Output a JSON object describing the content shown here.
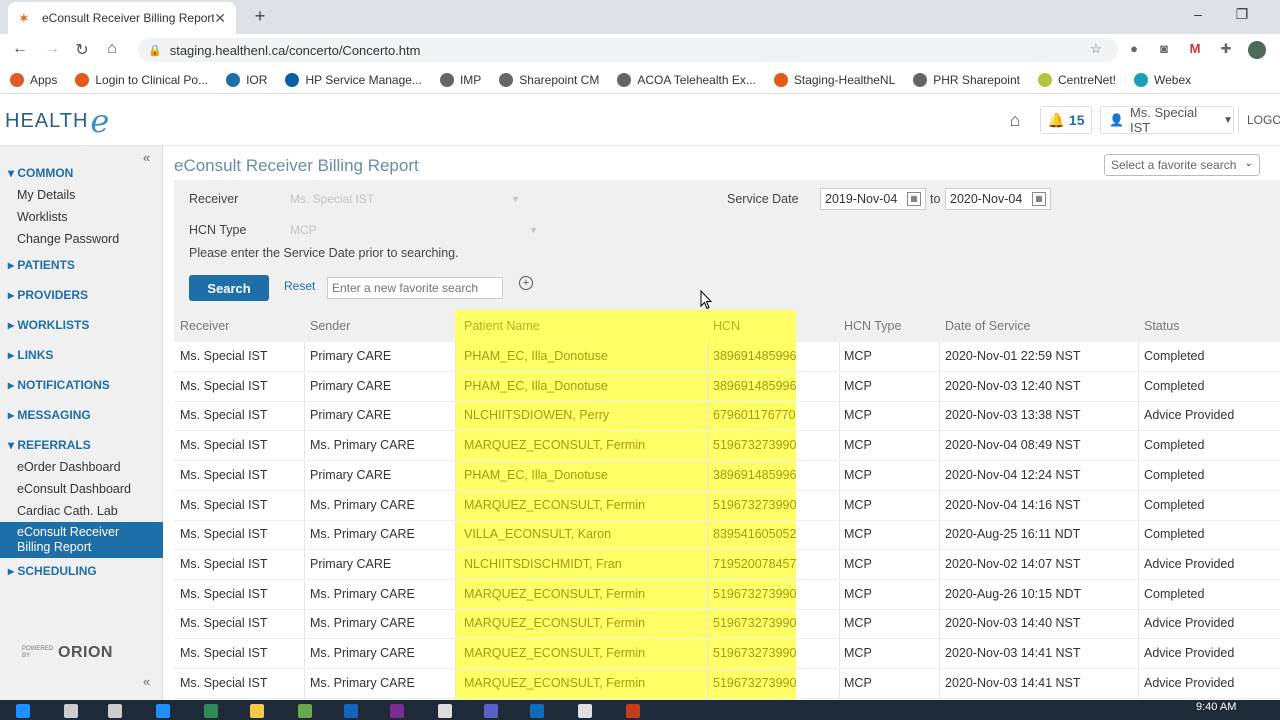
{
  "browser": {
    "tab_title": "eConsult Receiver Billing Report",
    "tab_close": "✕",
    "new_tab": "+",
    "url": "staging.healthenl.ca/concerto/Concerto.htm",
    "bookmarks": [
      {
        "label": "Apps",
        "icon": "apps-icon",
        "color": "#e05a2a"
      },
      {
        "label": "Login to Clinical Po...",
        "icon": "orion-icon",
        "color": "#e35b16"
      },
      {
        "label": "IOR",
        "icon": "ior-icon",
        "color": "#1e6ea8"
      },
      {
        "label": "HP Service Manage...",
        "icon": "hp-icon",
        "color": "#0a5fa8"
      },
      {
        "label": "IMP",
        "icon": "globe-icon",
        "color": "#666666"
      },
      {
        "label": "Sharepoint CM",
        "icon": "globe-icon",
        "color": "#666666"
      },
      {
        "label": "ACOA Telehealth Ex...",
        "icon": "globe-icon",
        "color": "#666666"
      },
      {
        "label": "Staging-HealtheNL",
        "icon": "orion-icon",
        "color": "#e35b16"
      },
      {
        "label": "PHR Sharepoint",
        "icon": "globe-icon",
        "color": "#666666"
      },
      {
        "label": "CentreNet!",
        "icon": "centrenet-icon",
        "color": "#b6c43a"
      },
      {
        "label": "Webex",
        "icon": "webex-icon",
        "color": "#1a9fb8"
      }
    ]
  },
  "app": {
    "logo_a": "HEALTH",
    "logo_b": "e",
    "notification_count": "15",
    "user_name": "Ms. Special IST",
    "logout": "LOGOUT"
  },
  "sidebar": {
    "sections": [
      {
        "label": "▾ COMMON",
        "items": [
          "My Details",
          "Worklists",
          "Change Password"
        ]
      },
      {
        "label": "▸ PATIENTS",
        "items": []
      },
      {
        "label": "▸ PROVIDERS",
        "items": []
      },
      {
        "label": "▸ WORKLISTS",
        "items": []
      },
      {
        "label": "▸ LINKS",
        "items": []
      },
      {
        "label": "▸ NOTIFICATIONS",
        "items": []
      },
      {
        "label": "▸ MESSAGING",
        "items": []
      },
      {
        "label": "▾ REFERRALS",
        "items": [
          "eOrder Dashboard",
          "eConsult Dashboard",
          "Cardiac Cath. Lab",
          "eConsult Receiver Billing Report"
        ]
      },
      {
        "label": "▸ SCHEDULING",
        "items": []
      }
    ],
    "powered_by": "POWERED BY",
    "orion": "ORION"
  },
  "page": {
    "title": "eConsult Receiver Billing Report",
    "favorite_select_placeholder": "Select a favorite search",
    "form": {
      "receiver_label": "Receiver",
      "receiver_value": "Ms. Special IST",
      "hcn_type_label": "HCN Type",
      "hcn_type_value": "MCP",
      "service_date_label": "Service Date",
      "date_from": "2019-Nov-04",
      "date_to_label": "to",
      "date_to": "2020-Nov-04",
      "hint": "Please enter the Service Date prior to searching.",
      "search_button": "Search",
      "reset_link": "Reset",
      "favorite_placeholder": "Enter a new favorite search"
    },
    "table": {
      "highlight_color": "#ffff66",
      "columns": [
        "Receiver",
        "Sender",
        "Patient Name",
        "HCN",
        "HCN Type",
        "Date of Service",
        "Status"
      ],
      "rows": [
        [
          "Ms. Special IST",
          "Primary CARE",
          "PHAM_EC, Illa_Donotuse",
          "389691485996",
          "MCP",
          "2020-Nov-01 22:59 NST",
          "Completed"
        ],
        [
          "Ms. Special IST",
          "Primary CARE",
          "PHAM_EC, Illa_Donotuse",
          "389691485996",
          "MCP",
          "2020-Nov-03 12:40 NST",
          "Completed"
        ],
        [
          "Ms. Special IST",
          "Primary CARE",
          "NLCHIITSDIOWEN, Perry",
          "679601176770",
          "MCP",
          "2020-Nov-03 13:38 NST",
          "Advice Provided"
        ],
        [
          "Ms. Special IST",
          "Ms. Primary CARE",
          "MARQUEZ_ECONSULT, Fermin",
          "519673273990",
          "MCP",
          "2020-Nov-04 08:49 NST",
          "Completed"
        ],
        [
          "Ms. Special IST",
          "Primary CARE",
          "PHAM_EC, Illa_Donotuse",
          "389691485996",
          "MCP",
          "2020-Nov-04 12:24 NST",
          "Completed"
        ],
        [
          "Ms. Special IST",
          "Ms. Primary CARE",
          "MARQUEZ_ECONSULT, Fermin",
          "519673273990",
          "MCP",
          "2020-Nov-04 14:16 NST",
          "Completed"
        ],
        [
          "Ms. Special IST",
          "Ms. Primary CARE",
          "VILLA_ECONSULT, Karon",
          "839541605052",
          "MCP",
          "2020-Aug-25 16:11 NDT",
          "Completed"
        ],
        [
          "Ms. Special IST",
          "Primary CARE",
          "NLCHIITSDISCHMIDT, Fran",
          "719520078457",
          "MCP",
          "2020-Nov-02 14:07 NST",
          "Advice Provided"
        ],
        [
          "Ms. Special IST",
          "Ms. Primary CARE",
          "MARQUEZ_ECONSULT, Fermin",
          "519673273990",
          "MCP",
          "2020-Aug-26 10:15 NDT",
          "Completed"
        ],
        [
          "Ms. Special IST",
          "Ms. Primary CARE",
          "MARQUEZ_ECONSULT, Fermin",
          "519673273990",
          "MCP",
          "2020-Nov-03 14:40 NST",
          "Advice Provided"
        ],
        [
          "Ms. Special IST",
          "Ms. Primary CARE",
          "MARQUEZ_ECONSULT, Fermin",
          "519673273990",
          "MCP",
          "2020-Nov-03 14:41 NST",
          "Advice Provided"
        ],
        [
          "Ms. Special IST",
          "Ms. Primary CARE",
          "MARQUEZ_ECONSULT, Fermin",
          "519673273990",
          "MCP",
          "2020-Nov-03 14:41 NST",
          "Advice Provided"
        ]
      ]
    }
  },
  "taskbar": {
    "clock": "9:40 AM"
  }
}
